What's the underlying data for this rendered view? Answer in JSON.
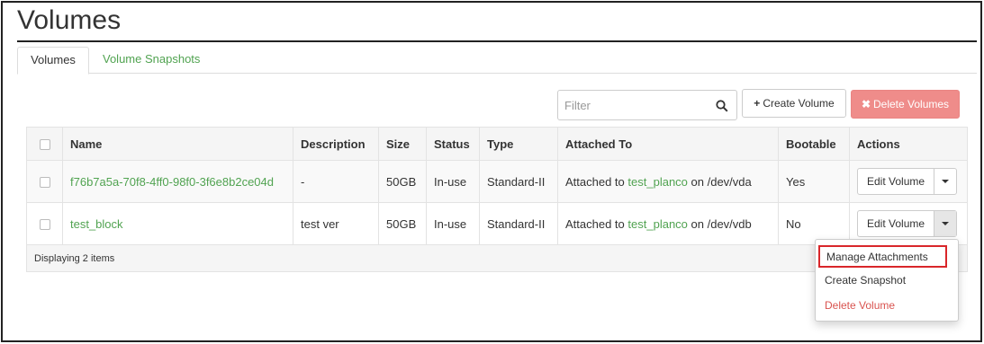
{
  "page": {
    "title": "Volumes"
  },
  "tabs": [
    {
      "label": "Volumes",
      "active": true
    },
    {
      "label": "Volume Snapshots",
      "active": false
    }
  ],
  "toolbar": {
    "filter_placeholder": "Filter",
    "create_label": "Create Volume",
    "delete_label": "Delete Volumes"
  },
  "table": {
    "headers": [
      "Name",
      "Description",
      "Size",
      "Status",
      "Type",
      "Attached To",
      "Bootable",
      "Actions"
    ],
    "rows": [
      {
        "name": "f76b7a5a-70f8-4ff0-98f0-3f6e8b2ce04d",
        "description": "-",
        "size": "50GB",
        "status": "In-use",
        "type": "Standard-II",
        "attached_prefix": "Attached to",
        "attached_instance": "test_planco",
        "attached_suffix": "on /dev/vda",
        "bootable": "Yes",
        "action": "Edit Volume"
      },
      {
        "name": "test_block",
        "description": "test ver",
        "size": "50GB",
        "status": "In-use",
        "type": "Standard-II",
        "attached_prefix": "Attached to",
        "attached_instance": "test_planco",
        "attached_suffix": "on /dev/vdb",
        "bootable": "No",
        "action": "Edit Volume"
      }
    ],
    "footer": "Displaying 2 items"
  },
  "dropdown": {
    "items": [
      "Manage Attachments",
      "Create Snapshot",
      "Delete Volume"
    ]
  },
  "colors": {
    "link_green": "#51a351",
    "danger_red": "#d9534f",
    "highlight_box": "#d9262a"
  }
}
